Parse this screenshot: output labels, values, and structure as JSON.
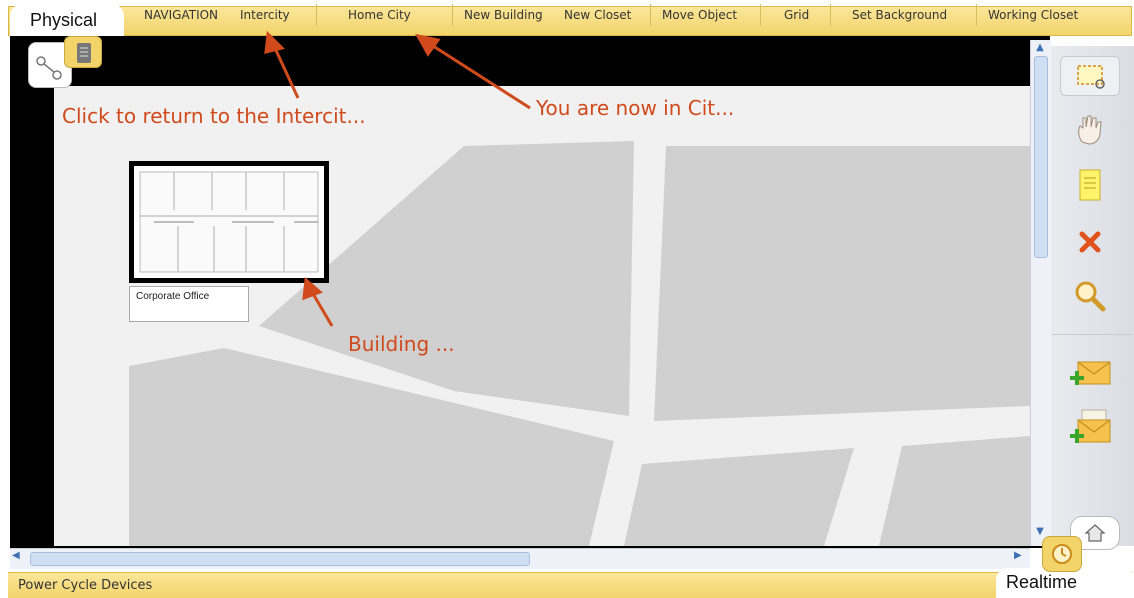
{
  "mode_tab": {
    "label": "Physical"
  },
  "menu": {
    "items": [
      {
        "label": "NAVIGATION"
      },
      {
        "label": "Intercity"
      },
      {
        "label": "Home City"
      },
      {
        "label": "New Building"
      },
      {
        "label": "New Closet"
      },
      {
        "label": "Move Object"
      },
      {
        "label": "Grid"
      },
      {
        "label": "Set Background"
      },
      {
        "label": "Working Closet"
      }
    ]
  },
  "map": {
    "building": {
      "name": "Corporate Office"
    }
  },
  "annotations": {
    "intercity_hint": "Click to return to the Intercit...",
    "city_hint": "You are now in Cit...",
    "building_hint": "Building ..."
  },
  "status_bar": {
    "left_label": "Power Cycle Devices",
    "time_mode": "Realtime"
  },
  "tools": {
    "icons": [
      "select-area-icon",
      "hand-icon",
      "note-icon",
      "delete-icon",
      "zoom-icon",
      "add-simple-pdu-icon",
      "add-complex-pdu-icon"
    ]
  },
  "colors": {
    "toolbar_yellow": "#f3d46b",
    "annotation_red": "#d04a1c",
    "road": "#f1f1f1",
    "block_gray": "#d0d0d0"
  }
}
